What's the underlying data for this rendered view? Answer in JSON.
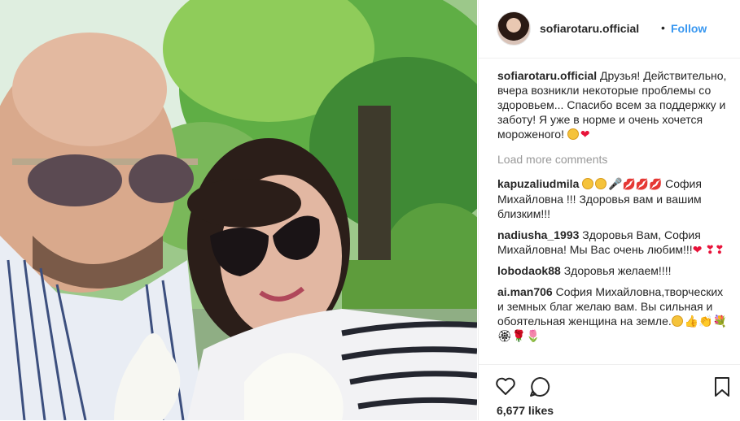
{
  "post": {
    "username": "sofiarotaru.official",
    "separator": "•",
    "follow_label": "Follow",
    "caption": "Друзья! Действительно, вчера возникли некоторые проблемы со здоровьем... Спасибо всем за поддержку и заботу! Я уже в норме и очень хочется мороженого!",
    "load_more": "Load more comments",
    "likes": "6,677 likes"
  },
  "comments": [
    {
      "user": "kapuzaliudmila",
      "text": "София Михайловна !!! Здоровья вам и вашим близким!!!"
    },
    {
      "user": "nadiusha_1993",
      "text": "Здоровья Вам, София Михайловна! Мы Вас очень любим!!!"
    },
    {
      "user": "lobodaok88",
      "text": "Здоровья желаем!!!!"
    },
    {
      "user": "ai.man706",
      "text": "София Михайловна,творческих и земных благ желаю вам. Вы сильная и обоятельная женщина на земле."
    }
  ],
  "icons": [
    "heart-icon",
    "comment-icon",
    "bookmark-icon"
  ],
  "colors": {
    "accent": "#3897f0",
    "text": "#262626",
    "muted": "#999999",
    "border": "#efefef"
  }
}
